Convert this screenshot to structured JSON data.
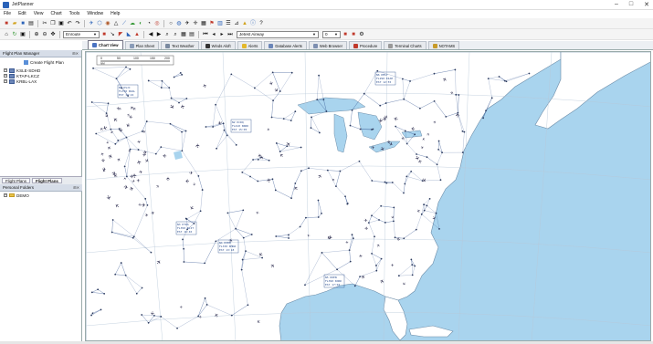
{
  "window": {
    "title": "JetPlanner",
    "min_glyph": "–",
    "max_glyph": "□",
    "close_glyph": "✕"
  },
  "menu": [
    "File",
    "Edit",
    "View",
    "Chart",
    "Tools",
    "Window",
    "Help"
  ],
  "toolbar": {
    "route_mode": "Enroute",
    "airway": "Jetest Airway",
    "level": "0"
  },
  "tabs": [
    {
      "label": "Chart View",
      "active": true,
      "color": "#4a73c2"
    },
    {
      "label": "Plan Sheet",
      "color": "#8a9cb8"
    },
    {
      "label": "Text Weather",
      "color": "#7a8aa0"
    },
    {
      "label": "Winds Aloft",
      "color": "#333333"
    },
    {
      "label": "Alerts",
      "color": "#e3b82a"
    },
    {
      "label": "Database Alerts",
      "color": "#6b86b8"
    },
    {
      "label": "Web Browser",
      "color": "#7d8fb0"
    },
    {
      "label": "Procedure",
      "color": "#c0392b"
    },
    {
      "label": "Terminal Charts",
      "color": "#999999"
    },
    {
      "label": "NOTAMS",
      "color": "#c79b2a"
    }
  ],
  "flight_plan_manager": {
    "title": "Flight Plan Manager",
    "pin_glyph": "⊞✕",
    "create_label": "Create Flight Plan",
    "items": [
      "KSLE-SDHD",
      "KTAP-LKCZ",
      "KRBL-LAX"
    ]
  },
  "bottom_tabs": [
    "Flight Plans",
    "Flight Plans"
  ],
  "personal_folders": {
    "title": "Personal Folders",
    "pin_glyph": "⊞✕",
    "items": [
      "DEMO"
    ]
  },
  "map": {
    "ocean_color": "#a9d4ee",
    "land_color": "#ffffff",
    "route_color": "#2d4f8f",
    "aircraft_color": "#3a3a5a",
    "scale_label": "NM",
    "scale_ticks": [
      "0",
      "50",
      "100",
      "150",
      "200"
    ],
    "tag_lines": [
      [
        "N1 KSJC",
        "FL370 KDAL",
        "EST 14:22"
      ],
      [
        "N2 KCRQ",
        "FL410 KRNO",
        "EST 15:05"
      ],
      [
        "N3 KTUS",
        "FL350 KLIT",
        "EST 16:40"
      ],
      [
        "N4 KORD",
        "FL330 KMDW",
        "EST 13:18"
      ],
      [
        "N5 KDEN",
        "FL390 KORD",
        "EST 17:02"
      ],
      [
        "N6 KMSY",
        "FL290 KIAH",
        "EST 12:55"
      ]
    ]
  }
}
